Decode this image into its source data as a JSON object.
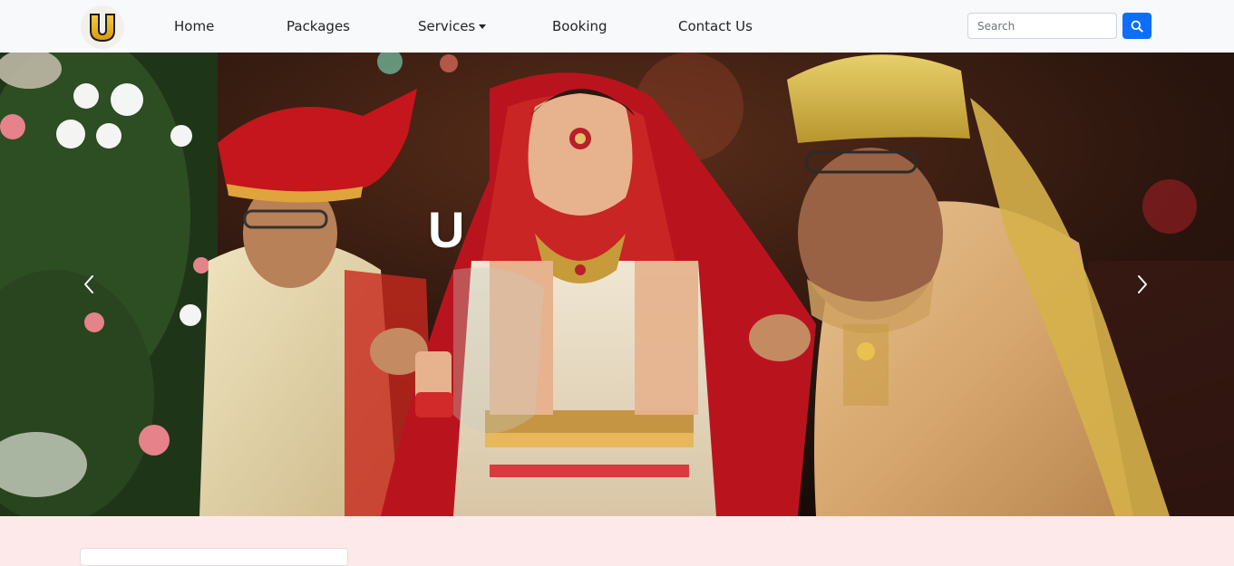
{
  "navbar": {
    "logo": {
      "letter": "U",
      "icon": "u-logo-icon"
    },
    "links": [
      {
        "label": "Home"
      },
      {
        "label": "Packages"
      },
      {
        "label": "Services",
        "has_dropdown": true
      },
      {
        "label": "Booking"
      },
      {
        "label": "Contact Us"
      }
    ],
    "search": {
      "placeholder": "Search",
      "value": "",
      "button_icon": "search-icon"
    }
  },
  "hero": {
    "caption": "U",
    "prev_icon": "chevron-left-icon",
    "next_icon": "chevron-right-icon"
  },
  "colors": {
    "navbar_bg": "#f8f9fa",
    "search_button": "#0d6efd",
    "logo_gold": "#e9b51f",
    "page_bg": "#fde9ea"
  }
}
